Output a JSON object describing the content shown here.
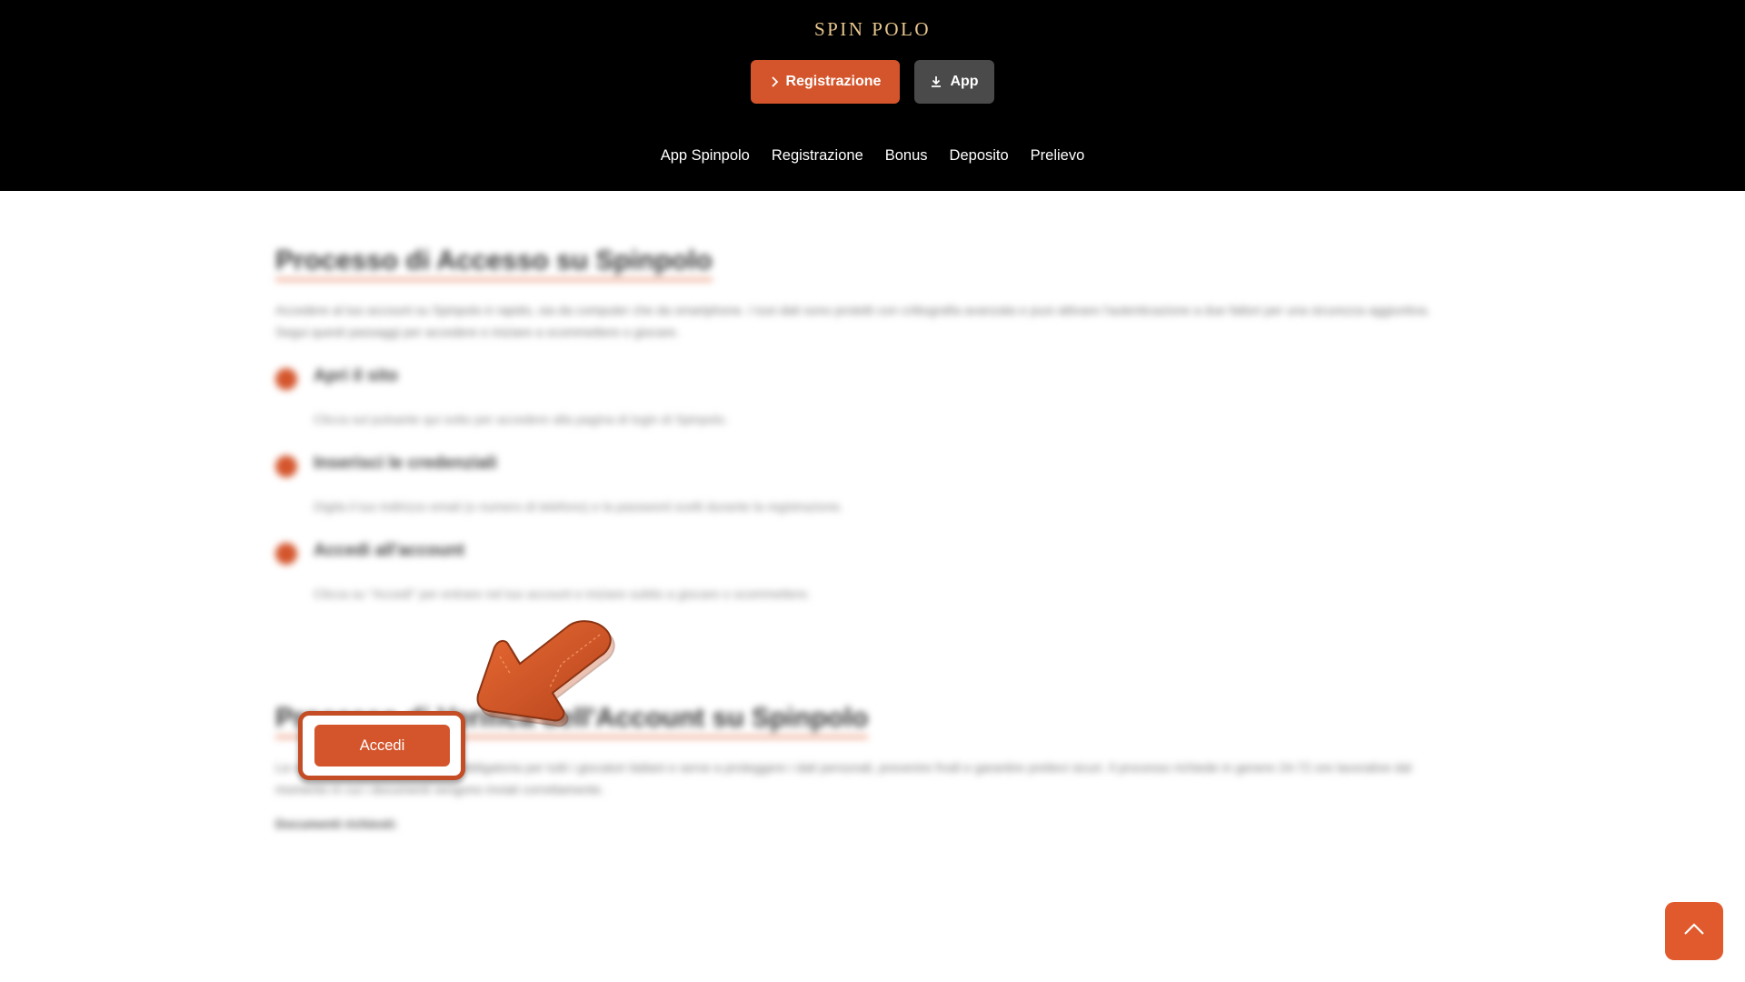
{
  "header": {
    "logo_text": "SPIN POLO",
    "buttons": {
      "register_label": "Registrazione",
      "register_icon": "chevron-right-icon",
      "app_label": "App",
      "app_icon": "download-icon"
    },
    "nav": [
      {
        "label": "App Spinpolo"
      },
      {
        "label": "Registrazione"
      },
      {
        "label": "Bonus"
      },
      {
        "label": "Deposito"
      },
      {
        "label": "Prelievo"
      }
    ]
  },
  "main": {
    "login_section": {
      "heading": "Processo di Accesso su Spinpolo",
      "intro": "Accedere al tuo account su Spinpolo è rapido, sia da computer che da smartphone. I tuoi dati sono protetti con crittografia avanzata e puoi attivare l'autenticazione a due fattori per una sicurezza aggiuntiva. Segui questi passaggi per accedere e iniziare a scommettere o giocare.",
      "steps": [
        {
          "title": "Apri il sito",
          "desc": "Clicca sul pulsante qui sotto per accedere alla pagina di login di Spinpolo."
        },
        {
          "title": "Inserisci le credenziali",
          "desc": "Digita il tuo indirizzo email (o numero di telefono) e la password scelti durante la registrazione."
        },
        {
          "title": "Accedi all'account",
          "desc": "Clicca su \"Accedi\" per entrare nel tuo account e iniziare subito a giocare o scommettere."
        }
      ],
      "cta_label": "Accedi"
    },
    "verify_section": {
      "heading": "Processo di Verifica dell'Account su Spinpolo",
      "intro": "La verifica dell'account (KYC) è obbligatoria per tutti i giocatori italiani e serve a proteggere i dati personali, prevenire frodi e garantire prelievi sicuri. Il processo richiede in genere 24-72 ore lavorative dal momento in cui i documenti vengono inviati correttamente.",
      "subheading": "Documenti richiesti:"
    }
  },
  "scroll_top_icon": "chevron-up-icon",
  "colors": {
    "accent": "#d4552c",
    "header_bg": "#000000",
    "logo": "#e9c78e",
    "app_button": "#4a4a4a"
  }
}
